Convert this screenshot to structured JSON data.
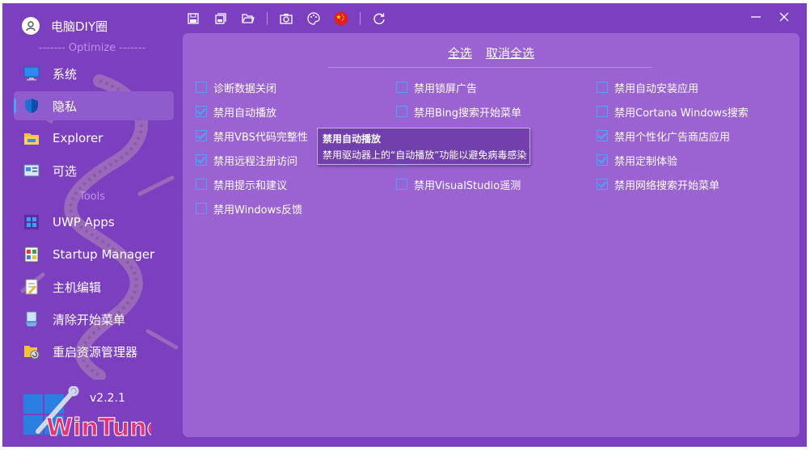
{
  "app": {
    "title": "电脑DIY圈",
    "version": "v2.2.1",
    "logo_text": "WinTune"
  },
  "sidebar": {
    "section_optimize": "------- Optimize -------",
    "section_tools": "Tools",
    "optimize_items": [
      {
        "label": "系统",
        "icon": "monitor-icon"
      },
      {
        "label": "隐私",
        "icon": "shield-icon",
        "active": true
      },
      {
        "label": "Explorer",
        "icon": "folder-icon"
      },
      {
        "label": "可选",
        "icon": "optional-icon"
      }
    ],
    "tools_items": [
      {
        "label": "UWP Apps",
        "icon": "windows-icon"
      },
      {
        "label": "Startup Manager",
        "icon": "startup-icon"
      },
      {
        "label": "主机编辑",
        "icon": "hosts-icon"
      },
      {
        "label": "清除开始菜单",
        "icon": "clean-start-icon"
      },
      {
        "label": "重启资源管理器",
        "icon": "restart-explorer-icon"
      }
    ]
  },
  "toolbar": [
    "save-icon",
    "save-all-icon",
    "open-folder-icon",
    "camera-icon",
    "palette-icon",
    "language-flag-icon",
    "refresh-icon"
  ],
  "main": {
    "select_all": "全选",
    "deselect_all": "取消全选",
    "options": [
      {
        "label": "诊断数据关闭",
        "checked": false
      },
      {
        "label": "禁用自动播放",
        "checked": true
      },
      {
        "label": "禁用VBS代码完整性",
        "checked": true
      },
      {
        "label": "禁用远程注册访问",
        "checked": true
      },
      {
        "label": "禁用提示和建议",
        "checked": false
      },
      {
        "label": "禁用Windows反馈",
        "checked": false
      },
      {
        "label": "禁用锁屏广告",
        "checked": false
      },
      {
        "label": "禁用Bing搜索开始菜单",
        "checked": false
      },
      {
        "label": "",
        "checked": false
      },
      {
        "label": "",
        "checked": false
      },
      {
        "label": "禁用VisualStudio遥测",
        "checked": false
      },
      {
        "label": "禁用自动安装应用",
        "checked": false
      },
      {
        "label": "禁用Cortana Windows搜索",
        "checked": false
      },
      {
        "label": "禁用个性化广告商店应用",
        "checked": true
      },
      {
        "label": "禁用定制体验",
        "checked": true
      },
      {
        "label": "禁用网络搜索开始菜单",
        "checked": true
      }
    ]
  },
  "tooltip": {
    "title": "禁用自动播放",
    "text": "禁用驱动器上的“自动播放”功能以避免病毒感染"
  },
  "colors": {
    "background": "#7b3fc0",
    "panel": "#9a63d1",
    "accent": "#4aa3ff"
  }
}
